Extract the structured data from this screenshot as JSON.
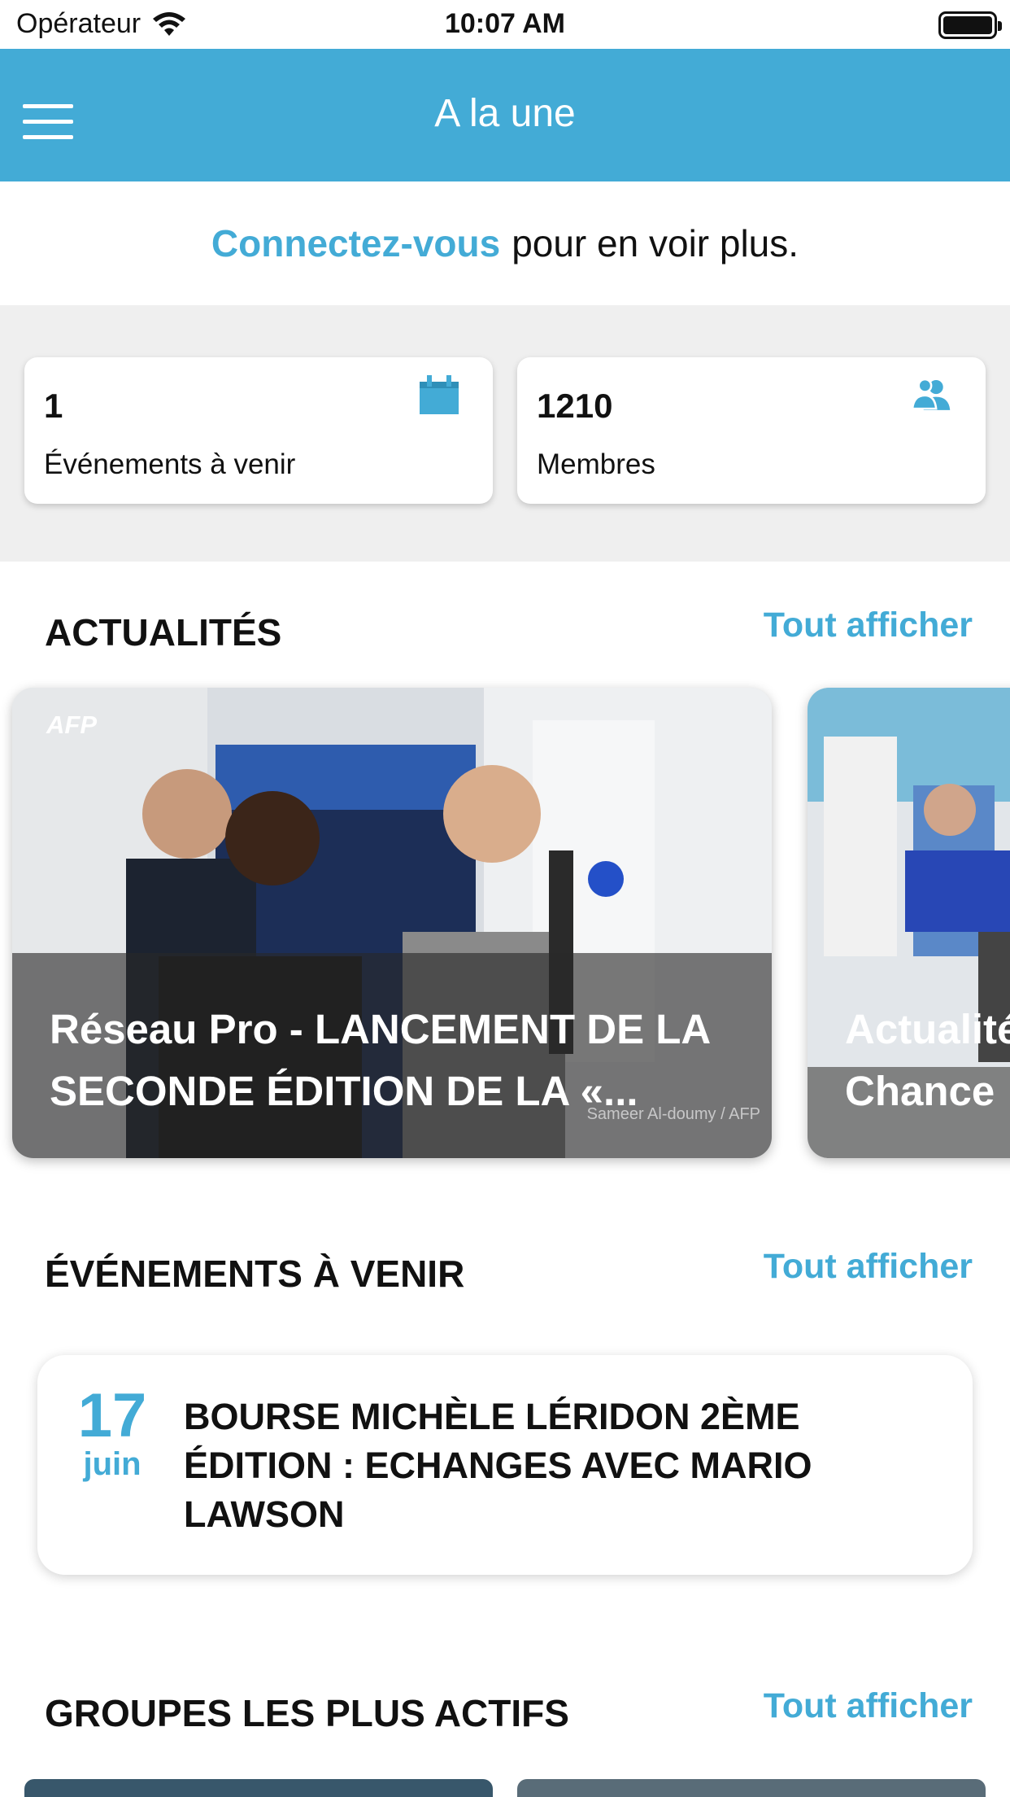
{
  "status_bar": {
    "carrier": "Opérateur",
    "time": "10:07 AM"
  },
  "nav": {
    "title": "A la une"
  },
  "login_prompt": {
    "link": "Connectez-vous",
    "text": "pour en voir plus."
  },
  "stats": [
    {
      "value": "1",
      "label": "Événements à venir",
      "icon": "calendar-icon"
    },
    {
      "value": "1210",
      "label": "Membres",
      "icon": "members-icon"
    }
  ],
  "sections": {
    "news": {
      "title": "ACTUALITÉS",
      "link": "Tout afficher"
    },
    "events": {
      "title": "ÉVÉNEMENTS À VENIR",
      "link": "Tout afficher"
    },
    "groups": {
      "title": "GROUPES LES PLUS ACTIFS",
      "link": "Tout afficher"
    }
  },
  "news": [
    {
      "title": "Réseau Pro - LANCEMENT DE LA SECONDE ÉDITION DE LA «...",
      "logo": "AFP",
      "credit": "Sameer Al-doumy / AFP"
    },
    {
      "title": "Actualité Chance"
    }
  ],
  "event": {
    "day": "17",
    "month": "juin",
    "title": "BOURSE MICHÈLE LÉRIDON 2ÈME ÉDITION : ECHANGES AVEC MARIO LAWSON"
  },
  "colors": {
    "accent": "#43abd6",
    "background_gray": "#efefef"
  }
}
